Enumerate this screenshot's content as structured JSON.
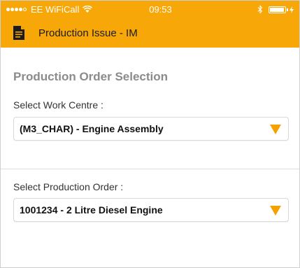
{
  "status_bar": {
    "carrier": "EE WiFiCall",
    "time": "09:53",
    "battery_level": 0.95
  },
  "header": {
    "title": "Production Issue - IM",
    "icon": "document-icon"
  },
  "page": {
    "section_title": "Production Order Selection"
  },
  "work_centre": {
    "label": "Select Work Centre :",
    "value": "(M3_CHAR) - Engine Assembly"
  },
  "production_order": {
    "label": "Select Production Order :",
    "value": "1001234 - 2 Litre Diesel Engine"
  },
  "colors": {
    "accent": "#f7a707",
    "arrow": "#f5a100",
    "section_title": "#8b8b8b"
  }
}
